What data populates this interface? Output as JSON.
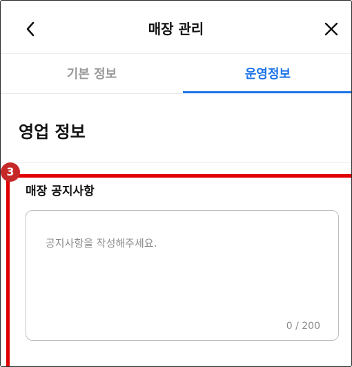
{
  "header": {
    "title": "매장 관리",
    "back_icon": "chevron-left-icon",
    "close_icon": "close-icon"
  },
  "tabs": [
    {
      "label": "기본 정보",
      "active": false
    },
    {
      "label": "운영정보",
      "active": true
    }
  ],
  "colors": {
    "accent": "#1a73e8",
    "highlight": "#e00000",
    "badge": "#c62828"
  },
  "section": {
    "title": "영업 정보"
  },
  "annotation": {
    "step": "3"
  },
  "notice": {
    "label": "매장 공지사항",
    "placeholder": "공지사항을 작성해주세요.",
    "value": "",
    "counter": "0 / 200"
  }
}
